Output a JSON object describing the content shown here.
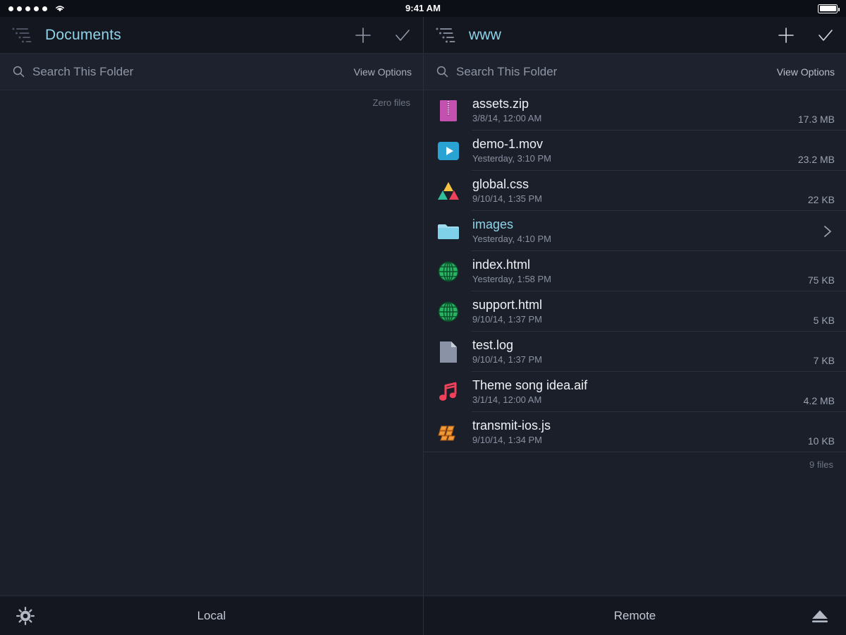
{
  "status_bar": {
    "signal_dots": 5,
    "wifi_icon": "wifi-icon",
    "time": "9:41 AM",
    "battery_icon": "battery-icon",
    "battery_level": 100
  },
  "colors": {
    "window_bg": "#1b1f2a",
    "navbar_bg": "#14171f",
    "searchbar_bg": "#1e222e",
    "accent_cyan": "#8fd3e8",
    "separator": "#2b3040",
    "text_primary": "#eef1f5",
    "text_secondary": "#8a91a1"
  },
  "left_pane": {
    "navbar": {
      "path_icon": "hierarchy-list-icon",
      "title": "Documents",
      "add_label": "+",
      "add_icon": "plus-icon",
      "confirm_icon": "checkmark-icon"
    },
    "search": {
      "icon": "search-icon",
      "placeholder": "Search This Folder",
      "value": "",
      "view_options_label": "View Options"
    },
    "count_label": "Zero files",
    "files": [],
    "toolbar": {
      "gear_icon": "gear-icon",
      "label": "Local"
    }
  },
  "right_pane": {
    "navbar": {
      "path_icon": "hierarchy-list-icon",
      "title": "www",
      "add_icon": "plus-icon",
      "confirm_icon": "checkmark-icon"
    },
    "search": {
      "icon": "search-icon",
      "placeholder": "Search This Folder",
      "value": "",
      "view_options_label": "View Options"
    },
    "files": [
      {
        "name": "assets.zip",
        "date": "3/8/14, 12:00 AM",
        "size": "17.3 MB",
        "icon": "zip-archive-icon",
        "is_folder": false
      },
      {
        "name": "demo-1.mov",
        "date": "Yesterday, 3:10 PM",
        "size": "23.2 MB",
        "icon": "movie-icon",
        "is_folder": false
      },
      {
        "name": "global.css",
        "date": "9/10/14, 1:35 PM",
        "size": "22 KB",
        "icon": "css-icon",
        "is_folder": false
      },
      {
        "name": "images",
        "date": "Yesterday, 4:10 PM",
        "size": "",
        "icon": "folder-icon",
        "is_folder": true
      },
      {
        "name": "index.html",
        "date": "Yesterday, 1:58 PM",
        "size": "75 KB",
        "icon": "html-globe-icon",
        "is_folder": false
      },
      {
        "name": "support.html",
        "date": "9/10/14, 1:37 PM",
        "size": "5 KB",
        "icon": "html-globe-icon",
        "is_folder": false
      },
      {
        "name": "test.log",
        "date": "9/10/14, 1:37 PM",
        "size": "7 KB",
        "icon": "generic-file-icon",
        "is_folder": false
      },
      {
        "name": "Theme song idea.aif",
        "date": "3/1/14, 12:00 AM",
        "size": "4.2 MB",
        "icon": "audio-note-icon",
        "is_folder": false
      },
      {
        "name": "transmit-ios.js",
        "date": "9/10/14, 1:34 PM",
        "size": "10 KB",
        "icon": "javascript-icon",
        "is_folder": false
      }
    ],
    "count_label": "9 files",
    "folder_chevron_icon": "chevron-right-icon",
    "toolbar": {
      "label": "Remote",
      "eject_icon": "eject-icon"
    }
  }
}
